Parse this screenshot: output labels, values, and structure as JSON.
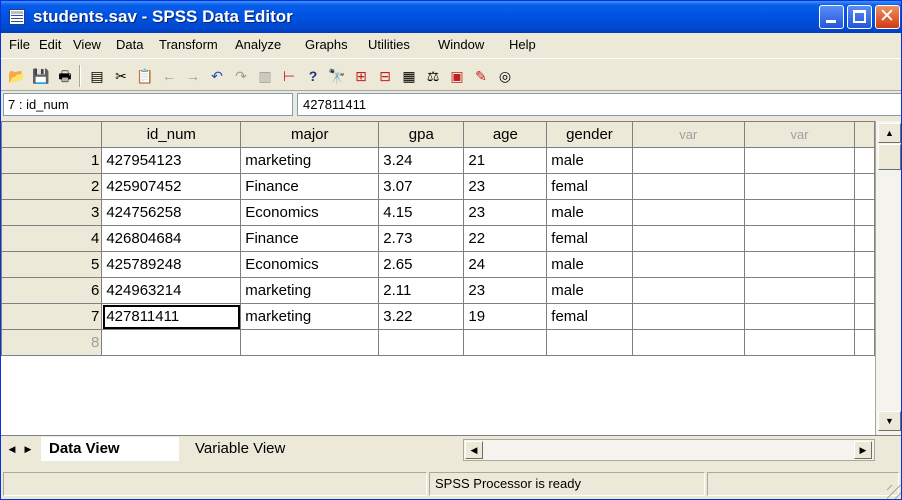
{
  "window": {
    "title": "students.sav - SPSS Data Editor",
    "close_glyph": "✕"
  },
  "menu": [
    "File",
    "Edit",
    "View",
    "Data",
    "Transform",
    "Analyze",
    "Graphs",
    "Utilities",
    "Window",
    "Help"
  ],
  "toolbar": {
    "icons": [
      "open-icon",
      "save-icon",
      "print-icon",
      "dialog-recall-icon",
      "cut-icon",
      "paste-icon",
      "back-icon",
      "forward-icon",
      "undo-icon",
      "redo-icon",
      "goto-chart-icon",
      "goto-case-icon",
      "variables-icon",
      "find-icon",
      "insert-case-icon",
      "insert-variable-icon",
      "split-file-icon",
      "weight-cases-icon",
      "select-cases-icon",
      "value-labels-icon",
      "use-sets-icon"
    ],
    "glyphs": {
      "open": "📂",
      "save": "💾",
      "print": "🖶",
      "dialog_recall": "▤",
      "cut": "✂",
      "paste": "📋",
      "back": "←",
      "forward": "→",
      "undo": "↶",
      "redo": "↷",
      "goto_chart": "▥",
      "goto_case": "⊢",
      "variables": "?",
      "find": "🔭",
      "insert_case": "⊞",
      "insert_variable": "⊟",
      "split_file": "▦",
      "weight_cases": "⚖",
      "select_cases": "▣",
      "value_labels": "✎",
      "use_sets": "◎"
    }
  },
  "cell_editor": {
    "reference": "7 : id_num",
    "value": "427811411"
  },
  "grid": {
    "columns": [
      "id_num",
      "major",
      "gpa",
      "age",
      "gender",
      "var",
      "var"
    ],
    "rows": [
      {
        "n": "1",
        "cells": [
          "427954123",
          "marketing",
          "3.24",
          "21",
          "male"
        ]
      },
      {
        "n": "2",
        "cells": [
          "425907452",
          "Finance",
          "3.07",
          "23",
          "femal"
        ]
      },
      {
        "n": "3",
        "cells": [
          "424756258",
          "Economics",
          "4.15",
          "23",
          "male"
        ]
      },
      {
        "n": "4",
        "cells": [
          "426804684",
          "Finance",
          "2.73",
          "22",
          "femal"
        ]
      },
      {
        "n": "5",
        "cells": [
          "425789248",
          "Economics",
          "2.65",
          "24",
          "male"
        ]
      },
      {
        "n": "6",
        "cells": [
          "424963214",
          "marketing",
          "2.11",
          "23",
          "male"
        ]
      },
      {
        "n": "7",
        "cells": [
          "427811411",
          "marketing",
          "3.22",
          "19",
          "femal"
        ]
      },
      {
        "n": "8",
        "cells": [
          "",
          "",
          "",
          "",
          ""
        ]
      }
    ],
    "active_cell": {
      "row": 7,
      "column": "id_num"
    }
  },
  "tabs": {
    "data_view": "Data View",
    "variable_view": "Variable View",
    "active": "Data View"
  },
  "arrows": {
    "up": "▲",
    "down": "▼",
    "left": "◀",
    "right": "▶"
  },
  "status": {
    "text": "SPSS Processor  is ready"
  },
  "colors": {
    "titlebar": "#0055E5",
    "chrome": "#ECE9D8",
    "grid_line": "#808080"
  }
}
